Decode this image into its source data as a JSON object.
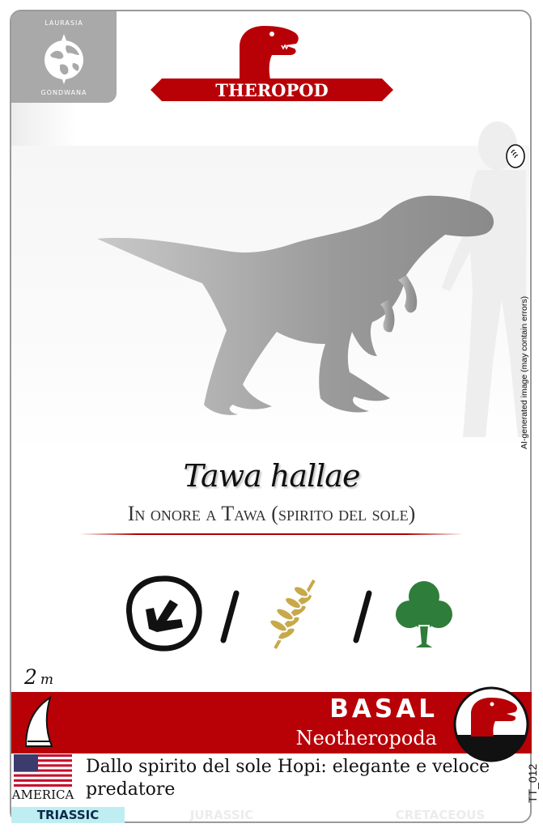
{
  "card": {
    "group": "THEROPOD",
    "corner": {
      "top": "LAURASIA",
      "bottom": "GONDWANA"
    },
    "species": "Tawa hallae",
    "meaning": "In onore a Tawa (spirito del sole)",
    "ai_note": "AI-generated image (may contain errors)",
    "length": {
      "value": "2",
      "unit": "m"
    },
    "clade": "BASAL",
    "subclade": "Neotheropoda",
    "country": "AMERICA",
    "description": "Dallo spirito del sole Hopi: elegante e veloce predatore",
    "card_id": "TT_012",
    "periods": [
      {
        "label": "TRIASSIC",
        "active": true
      },
      {
        "label": "JURASSIC",
        "active": false
      },
      {
        "label": "CRETACEOUS",
        "active": false
      }
    ],
    "icons": [
      "footprint-icon",
      "fern-leaf-icon",
      "tree-icon"
    ],
    "separator": "/",
    "colors": {
      "accent": "#b80007",
      "triassic": "#bfeef2",
      "frame": "#9a9a9a"
    }
  }
}
